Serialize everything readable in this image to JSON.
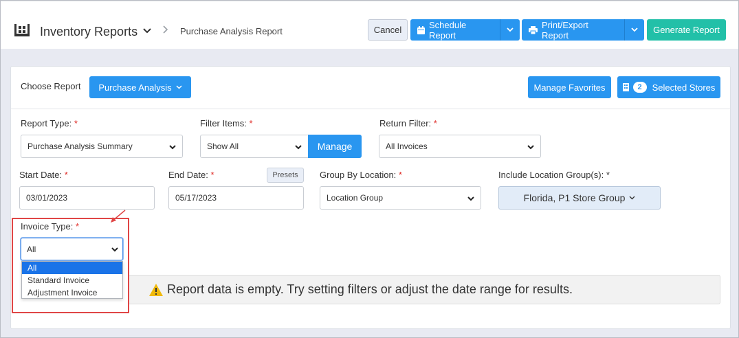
{
  "header": {
    "title": "Inventory Reports",
    "breadcrumb": "Purchase Analysis Report",
    "cancel_label": "Cancel",
    "schedule_label": "Schedule Report",
    "print_label": "Print/Export Report",
    "generate_label": "Generate Report"
  },
  "toolbar": {
    "choose_label": "Choose Report",
    "report_button_label": "Purchase Analysis",
    "favorites_label": "Manage Favorites",
    "stores_count": "2",
    "stores_label": "Selected Stores"
  },
  "filters": {
    "report_type": {
      "label": "Report Type:",
      "required_mark": "*",
      "value": "Purchase Analysis Summary"
    },
    "filter_items": {
      "label": "Filter Items:",
      "required_mark": "*",
      "value": "Show All",
      "manage_label": "Manage"
    },
    "return_filter": {
      "label": "Return Filter:",
      "required_mark": "*",
      "value": "All Invoices"
    },
    "start_date": {
      "label": "Start Date:",
      "required_mark": "*",
      "value": "03/01/2023"
    },
    "end_date": {
      "label": "End Date:",
      "required_mark": "*",
      "value": "05/17/2023",
      "presets_label": "Presets"
    },
    "group_by": {
      "label": "Group By Location:",
      "required_mark": "*",
      "value": "Location Group"
    },
    "location_groups": {
      "label": "Include Location Group(s):",
      "required_mark": "*",
      "value": "Florida, P1 Store Group"
    },
    "invoice_type": {
      "label": "Invoice Type:",
      "required_mark": "*",
      "value": "All",
      "options": [
        "All",
        "Standard Invoice",
        "Adjustment Invoice"
      ]
    }
  },
  "alert": {
    "message": "Report data is empty. Try setting filters or adjust the date range for results."
  },
  "colors": {
    "primary": "#2996f0",
    "teal": "#22c0a8",
    "required": "#e0302b",
    "highlight": "#e04646",
    "warning": "#f0b90b"
  },
  "icons": [
    "inventory-icon",
    "chevron-down-icon",
    "calendar-icon",
    "printer-icon",
    "building-icon",
    "warning-icon",
    "arrow-icon"
  ]
}
